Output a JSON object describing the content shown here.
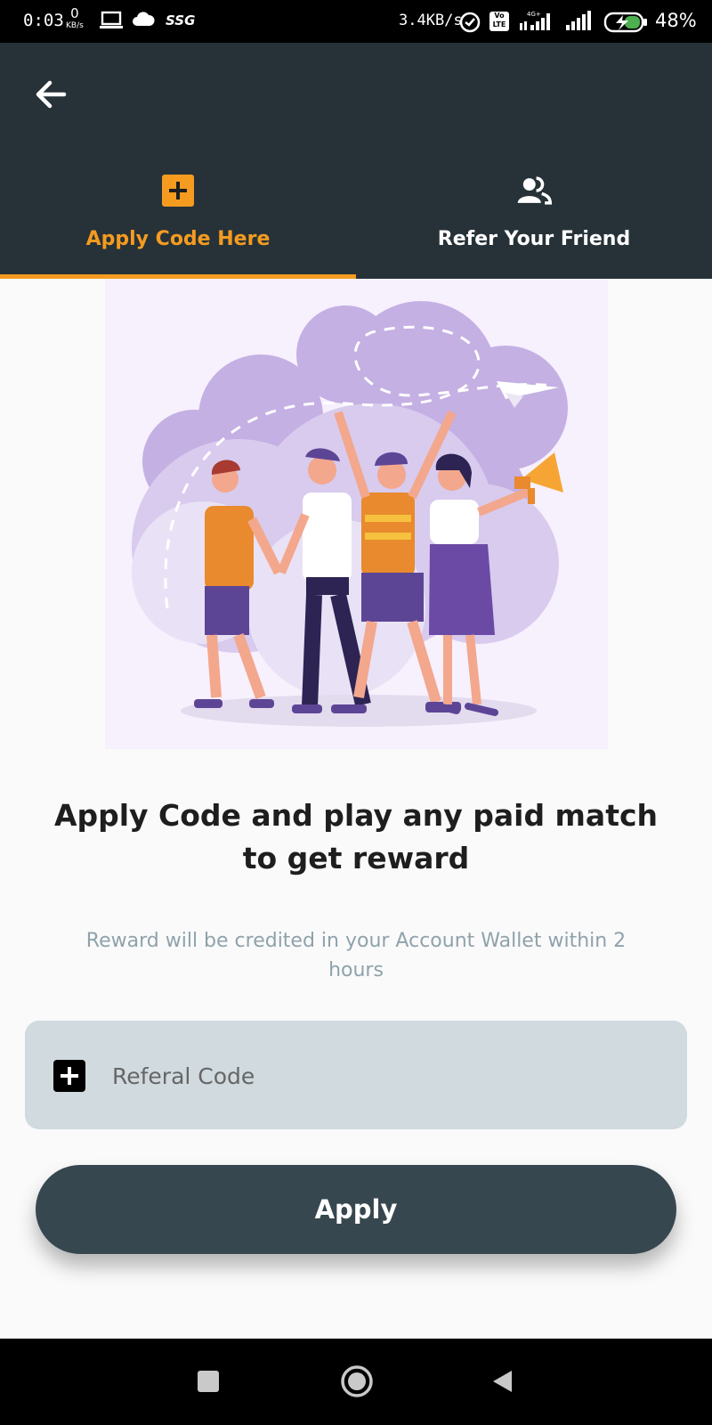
{
  "status_bar": {
    "time": "0:03",
    "net_rate_value": "0",
    "net_rate_unit": "KB/s",
    "carrier_tag": "SSG",
    "speed": "3.4KB/s",
    "volte": "Vo LTE",
    "network_type": "4G+",
    "battery_percent": "48%",
    "icons": [
      "laptop-icon",
      "cloud-icon",
      "alarm-icon",
      "signal-icon",
      "battery-charging-icon"
    ]
  },
  "header": {
    "back_icon": "arrow-left-icon",
    "tabs": [
      {
        "label": "Apply Code Here",
        "icon": "plus-box-icon",
        "active": true
      },
      {
        "label": "Refer Your Friend",
        "icon": "people-icon",
        "active": false
      }
    ]
  },
  "main": {
    "headline": "Apply Code and play any paid match to get reward",
    "subtext": "Reward will be credited in your Account Wallet within 2 hours",
    "code_field": {
      "placeholder": "Referal Code",
      "value": "",
      "icon": "plus-box-icon"
    },
    "apply_label": "Apply"
  },
  "colors": {
    "header_bg": "#263238",
    "accent": "#f59b20",
    "button_bg": "#37474f",
    "field_bg": "#d0dadf",
    "subtext": "#8fa2ab"
  },
  "nav_bar": {
    "icons": [
      "recents-icon",
      "home-icon",
      "back-triangle-icon"
    ]
  }
}
